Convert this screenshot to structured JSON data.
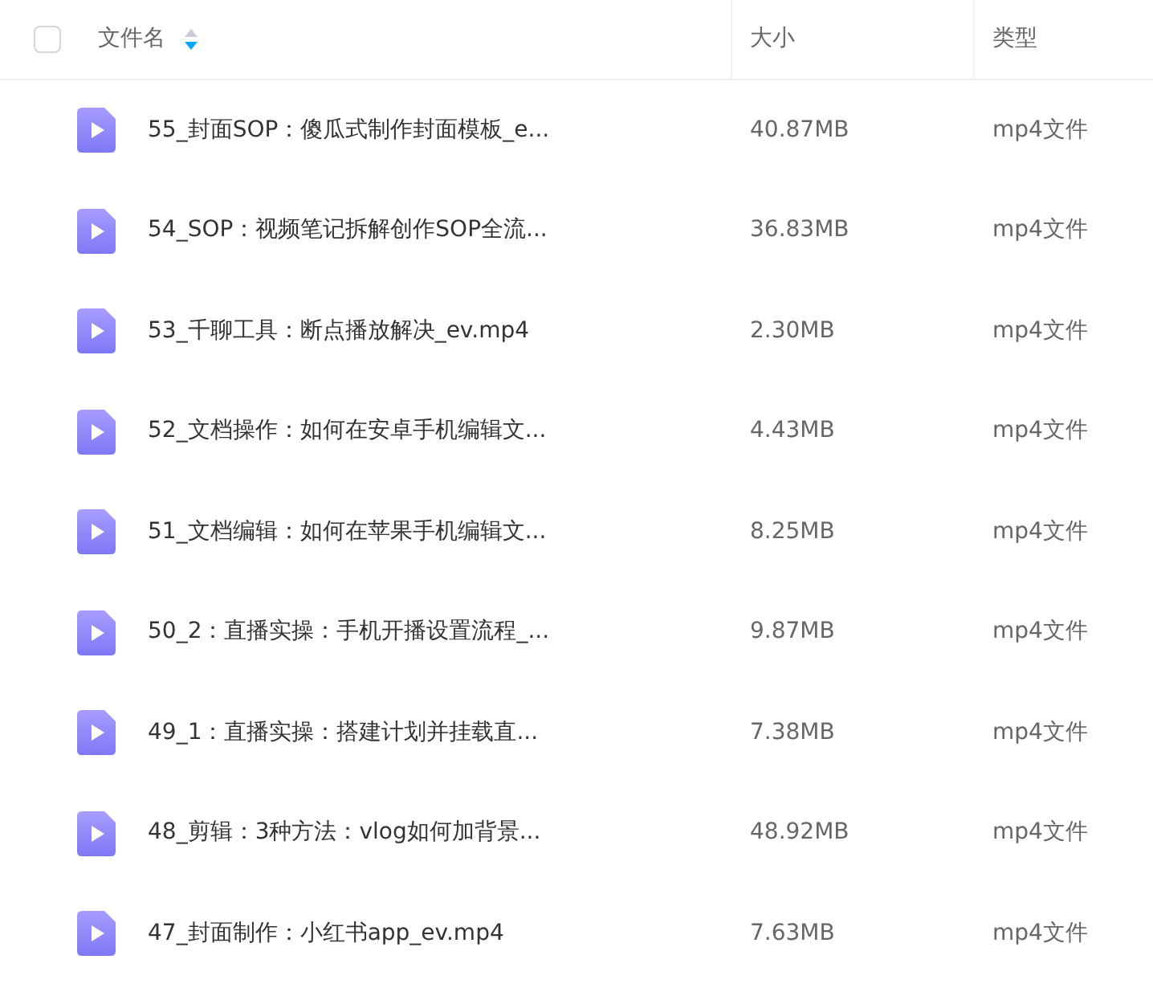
{
  "header": {
    "select_all": {
      "checked": false
    },
    "columns": [
      {
        "label": "文件名",
        "sort_descending": true
      },
      {
        "label": "大小"
      },
      {
        "label": "类型"
      }
    ]
  },
  "files": [
    {
      "name": "55_封面SOP：傻瓜式制作封面模板_e...",
      "size": "40.87MB",
      "type": "mp4文件"
    },
    {
      "name": "54_SOP：视频笔记拆解创作SOP全流...",
      "size": "36.83MB",
      "type": "mp4文件"
    },
    {
      "name": "53_千聊工具：断点播放解决_ev.mp4",
      "size": "2.30MB",
      "type": "mp4文件"
    },
    {
      "name": "52_文档操作：如何在安卓手机编辑文...",
      "size": "4.43MB",
      "type": "mp4文件"
    },
    {
      "name": "51_文档编辑：如何在苹果手机编辑文...",
      "size": "8.25MB",
      "type": "mp4文件"
    },
    {
      "name": "50_2：直播实操：手机开播设置流程_...",
      "size": "9.87MB",
      "type": "mp4文件"
    },
    {
      "name": "49_1：直播实操：搭建计划并挂载直...",
      "size": "7.38MB",
      "type": "mp4文件"
    },
    {
      "name": "48_剪辑：3种方法：vlog如何加背景...",
      "size": "48.92MB",
      "type": "mp4文件"
    },
    {
      "name": "47_封面制作：小红书app_ev.mp4",
      "size": "7.63MB",
      "type": "mp4文件"
    }
  ]
}
